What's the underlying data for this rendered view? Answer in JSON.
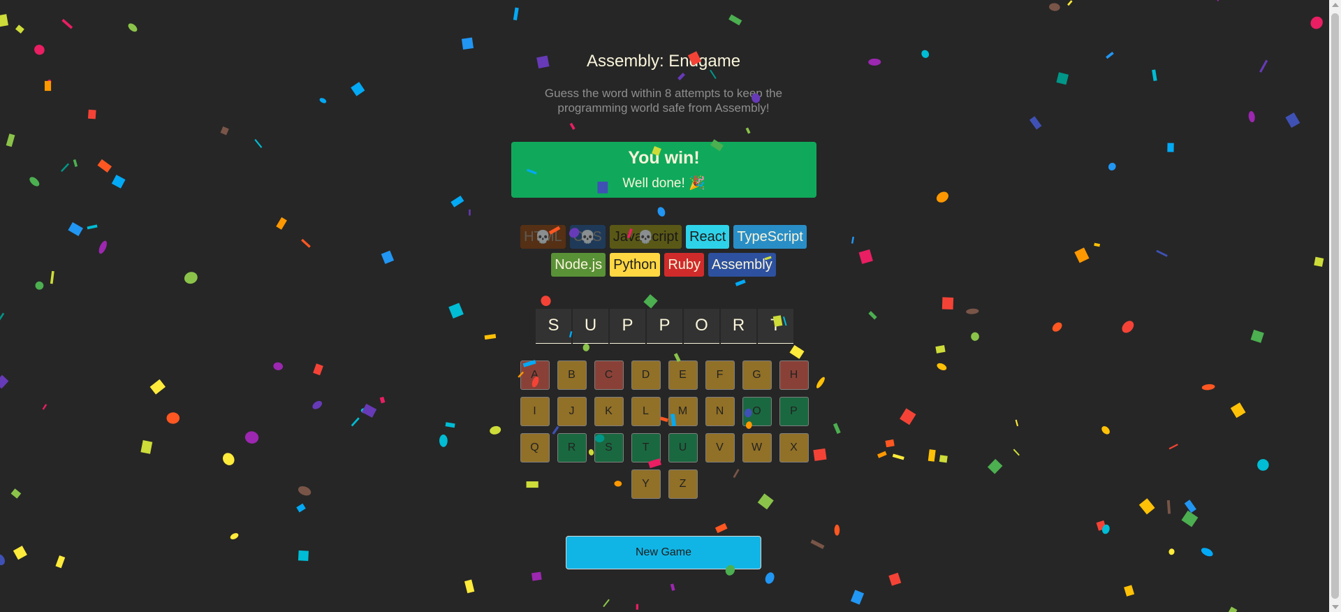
{
  "header": {
    "title": "Assembly: Endgame",
    "subtitle": "Guess the word within 8 attempts to keep the programming world safe from Assembly!"
  },
  "status": {
    "heading": "You win!",
    "message": "Well done! 🎉"
  },
  "languages": [
    {
      "name": "HTML",
      "bg": "#E2680F",
      "color": "#F9F4DA",
      "lost": true
    },
    {
      "name": "CSS",
      "bg": "#328AF1",
      "color": "#F9F4DA",
      "lost": true
    },
    {
      "name": "JavaScript",
      "bg": "#F4EB13",
      "color": "#1E1E1E",
      "lost": true
    },
    {
      "name": "React",
      "bg": "#2ED3E9",
      "color": "#1E1E1E",
      "lost": false
    },
    {
      "name": "TypeScript",
      "bg": "#298EC6",
      "color": "#F9F4DA",
      "lost": false
    },
    {
      "name": "Node.js",
      "bg": "#599137",
      "color": "#F9F4DA",
      "lost": false
    },
    {
      "name": "Python",
      "bg": "#FFD742",
      "color": "#1E1E1E",
      "lost": false
    },
    {
      "name": "Ruby",
      "bg": "#D02B2B",
      "color": "#F9F4DA",
      "lost": false
    },
    {
      "name": "Assembly",
      "bg": "#2D519F",
      "color": "#F9F4DA",
      "lost": false
    }
  ],
  "lost_icon": "💀",
  "word": [
    "S",
    "U",
    "P",
    "P",
    "O",
    "R",
    "T"
  ],
  "keyboard": [
    {
      "letter": "A",
      "state": "absent"
    },
    {
      "letter": "B",
      "state": "unused"
    },
    {
      "letter": "C",
      "state": "absent"
    },
    {
      "letter": "D",
      "state": "unused"
    },
    {
      "letter": "E",
      "state": "unused"
    },
    {
      "letter": "F",
      "state": "unused"
    },
    {
      "letter": "G",
      "state": "unused"
    },
    {
      "letter": "H",
      "state": "absent"
    },
    {
      "letter": "I",
      "state": "unused"
    },
    {
      "letter": "J",
      "state": "unused"
    },
    {
      "letter": "K",
      "state": "unused"
    },
    {
      "letter": "L",
      "state": "unused"
    },
    {
      "letter": "M",
      "state": "unused"
    },
    {
      "letter": "N",
      "state": "unused"
    },
    {
      "letter": "O",
      "state": "correct"
    },
    {
      "letter": "P",
      "state": "correct"
    },
    {
      "letter": "Q",
      "state": "unused"
    },
    {
      "letter": "R",
      "state": "correct"
    },
    {
      "letter": "S",
      "state": "correct"
    },
    {
      "letter": "T",
      "state": "correct"
    },
    {
      "letter": "U",
      "state": "correct"
    },
    {
      "letter": "V",
      "state": "unused"
    },
    {
      "letter": "W",
      "state": "unused"
    },
    {
      "letter": "X",
      "state": "unused"
    },
    {
      "letter": "Y",
      "state": "unused"
    },
    {
      "letter": "Z",
      "state": "unused"
    }
  ],
  "new_game_label": "New Game",
  "confetti_colors": [
    "#F44336",
    "#E91E63",
    "#9C27B0",
    "#673AB7",
    "#3F51B5",
    "#2196F3",
    "#03A9F4",
    "#00BCD4",
    "#009688",
    "#4CAF50",
    "#8BC34A",
    "#CDDC39",
    "#FFEB3B",
    "#FFC107",
    "#FF9800",
    "#FF5722",
    "#795548"
  ]
}
